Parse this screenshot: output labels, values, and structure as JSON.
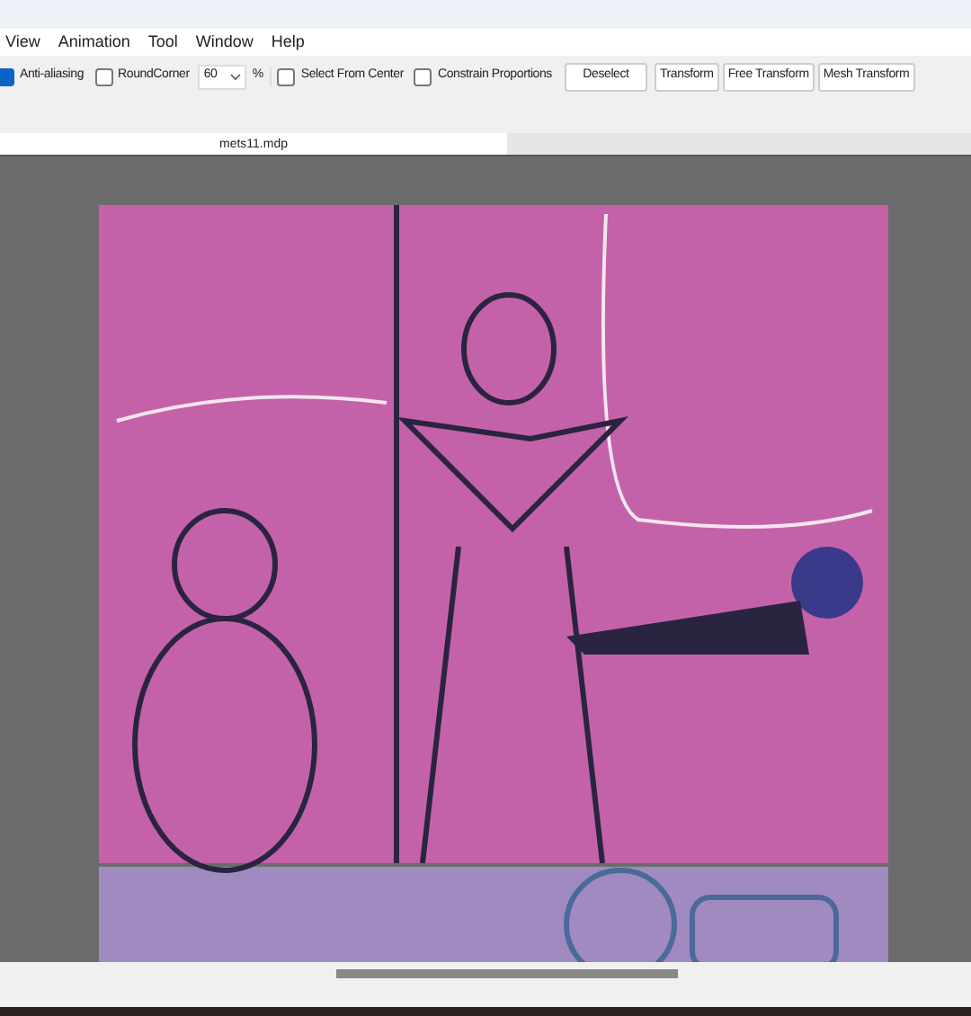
{
  "menu": [
    "View",
    "Animation",
    "Tool",
    "Window",
    "Help"
  ],
  "toolbar": [
    {
      "kind": "checkbox",
      "label": "Anti-aliasing",
      "checked": true
    },
    {
      "kind": "checkbox",
      "label": "RoundCorner",
      "checked": false
    },
    {
      "kind": "select",
      "value": "60"
    },
    {
      "kind": "unit",
      "label": "%"
    },
    {
      "kind": "checkbox",
      "label": "Select From Center",
      "checked": false
    },
    {
      "kind": "checkbox",
      "label": "Constrain Proportions",
      "checked": false
    },
    {
      "kind": "button",
      "label": "Deselect"
    },
    {
      "kind": "button",
      "label": "Transform"
    },
    {
      "kind": "button",
      "label": "Free Transform"
    },
    {
      "kind": "button",
      "label": "Mesh Transform"
    }
  ],
  "tabs": [
    {
      "label": "mets11.mdp",
      "selected": true
    }
  ]
}
